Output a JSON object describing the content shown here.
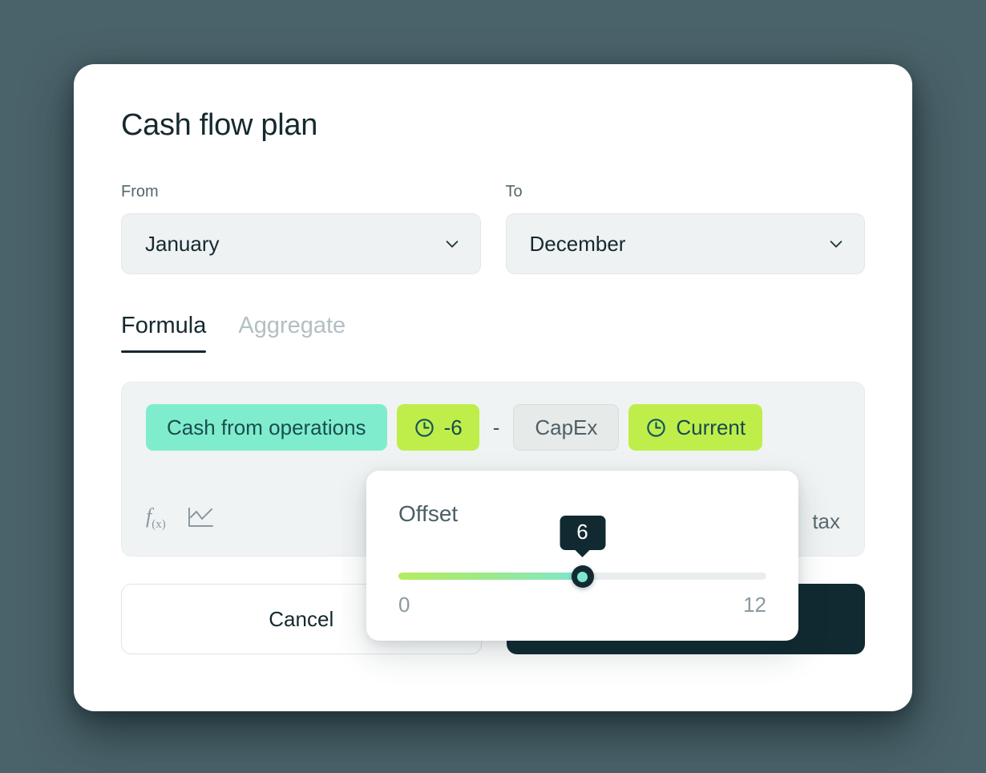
{
  "dialog": {
    "title": "Cash flow plan",
    "from": {
      "label": "From",
      "value": "January"
    },
    "to": {
      "label": "To",
      "value": "December"
    },
    "tabs": [
      {
        "label": "Formula",
        "active": true
      },
      {
        "label": "Aggregate",
        "active": false
      }
    ],
    "formula": {
      "tokens": [
        {
          "type": "metric",
          "label": "Cash from operations",
          "style": "teal"
        },
        {
          "type": "offset",
          "label": "-6",
          "style": "lime",
          "icon": "clock-icon"
        },
        {
          "type": "operator",
          "label": "-"
        },
        {
          "type": "metric",
          "label": "CapEx",
          "style": "gray"
        },
        {
          "type": "offset",
          "label": "Current",
          "style": "lime",
          "icon": "clock-icon"
        }
      ],
      "tools": [
        {
          "name": "function-icon",
          "label": "f",
          "sub": "(x)"
        },
        {
          "name": "line-chart-icon"
        }
      ],
      "trailing_text": "tax"
    },
    "footer": {
      "cancel_label": "Cancel",
      "confirm_label": ""
    }
  },
  "popover": {
    "title": "Offset",
    "value": "6",
    "min_label": "0",
    "max_label": "12",
    "min": 0,
    "max": 12
  },
  "colors": {
    "backdrop": "#4a6269",
    "card": "#ffffff",
    "ink": "#15292f",
    "muted": "#56666c",
    "teal_chip": "#7fedcd",
    "lime_chip": "#bfee4b",
    "gray_chip": "#e6eae9",
    "primary_button": "#112a31",
    "slider_start": "#b5ec5f",
    "slider_end": "#7fe6cf",
    "thumb_core": "#7fe6d0"
  }
}
